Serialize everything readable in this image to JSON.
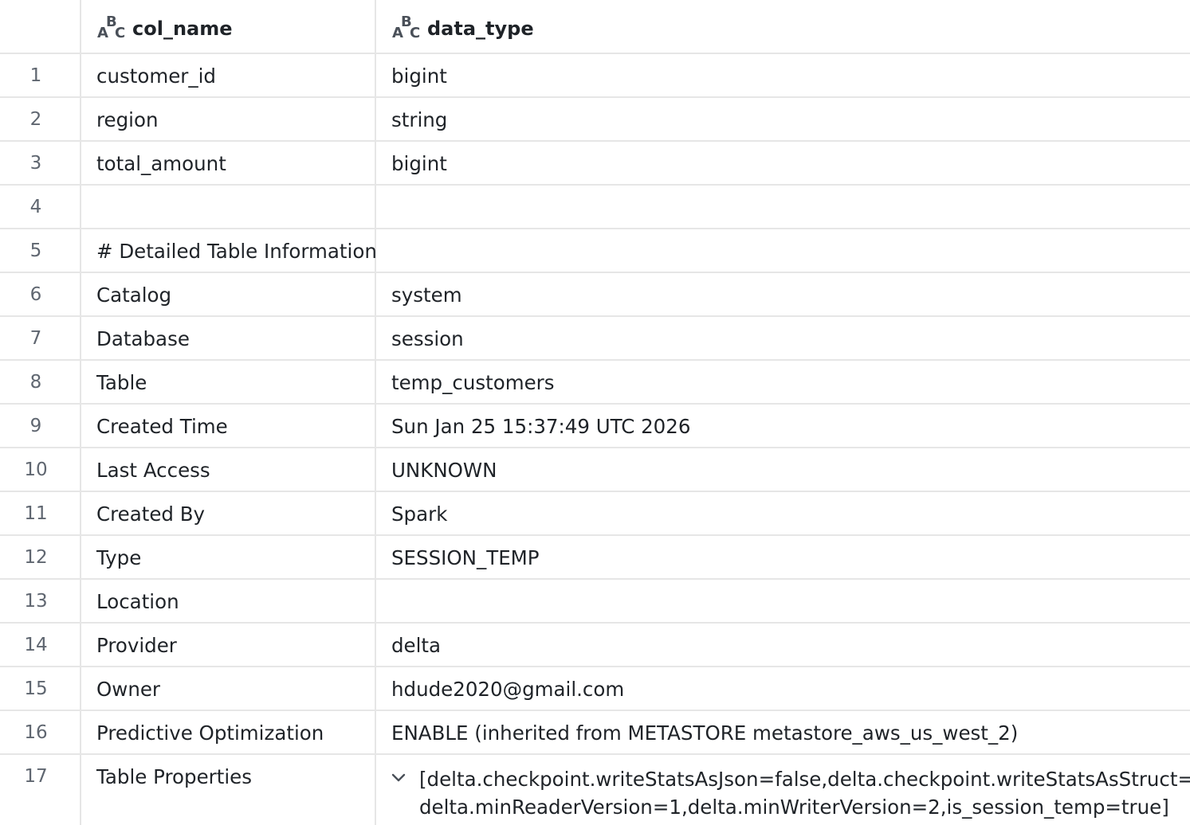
{
  "columns": {
    "col_name": "col_name",
    "data_type": "data_type"
  },
  "icons": {
    "type_icon": "abc-string-type-icon",
    "expand_icon": "chevron-down-icon"
  },
  "rows": [
    {
      "n": "1",
      "col_name": "customer_id",
      "data_type": "bigint"
    },
    {
      "n": "2",
      "col_name": "region",
      "data_type": "string"
    },
    {
      "n": "3",
      "col_name": "total_amount",
      "data_type": "bigint"
    },
    {
      "n": "4",
      "col_name": "",
      "data_type": ""
    },
    {
      "n": "5",
      "col_name": "# Detailed Table Information",
      "data_type": ""
    },
    {
      "n": "6",
      "col_name": "Catalog",
      "data_type": "system"
    },
    {
      "n": "7",
      "col_name": "Database",
      "data_type": "session"
    },
    {
      "n": "8",
      "col_name": "Table",
      "data_type": "temp_customers"
    },
    {
      "n": "9",
      "col_name": "Created Time",
      "data_type": "Sun Jan 25 15:37:49 UTC 2026"
    },
    {
      "n": "10",
      "col_name": "Last Access",
      "data_type": "UNKNOWN"
    },
    {
      "n": "11",
      "col_name": "Created By",
      "data_type": "Spark"
    },
    {
      "n": "12",
      "col_name": "Type",
      "data_type": "SESSION_TEMP"
    },
    {
      "n": "13",
      "col_name": "Location",
      "data_type": ""
    },
    {
      "n": "14",
      "col_name": "Provider",
      "data_type": "delta"
    },
    {
      "n": "15",
      "col_name": "Owner",
      "data_type": "hdude2020@gmail.com"
    },
    {
      "n": "16",
      "col_name": "Predictive Optimization",
      "data_type": "ENABLE (inherited from METASTORE metastore_aws_us_west_2)"
    }
  ],
  "last_row": {
    "n": "17",
    "col_name": "Table Properties",
    "data_type_line1": "[delta.checkpoint.writeStatsAsJson=false,delta.checkpoint.writeStatsAsStruct=true,",
    "data_type_line2": "delta.minReaderVersion=1,delta.minWriterVersion=2,is_session_temp=true]"
  }
}
